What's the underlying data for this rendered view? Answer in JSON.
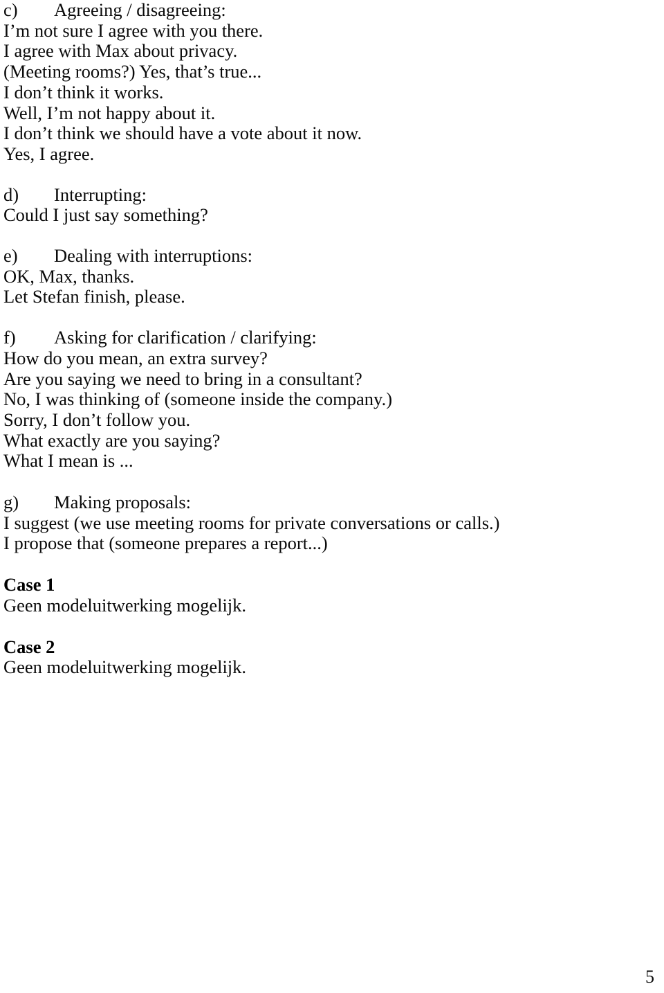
{
  "document": {
    "page_number": "5",
    "sections": [
      {
        "id": "section-c",
        "label": "c)",
        "title": "Agreeing / disagreeing:",
        "lines": [
          "I’m not sure I agree with you there.",
          "I agree with Max about privacy.",
          "(Meeting rooms?) Yes, that’s true...",
          "I don’t think it works.",
          "Well, I’m not happy about it.",
          "I don’t think we should have a vote about it now.",
          "Yes, I agree."
        ]
      },
      {
        "id": "section-d",
        "label": "d)",
        "title": "Interrupting:",
        "lines": [
          "Could I just say something?"
        ]
      },
      {
        "id": "section-e",
        "label": "e)",
        "title": "Dealing with interruptions:",
        "lines": [
          "OK, Max, thanks.",
          "Let Stefan finish, please."
        ]
      },
      {
        "id": "section-f",
        "label": "f)",
        "title": "Asking for clarification / clarifying:",
        "lines": [
          "How do you mean, an extra survey?",
          "Are you saying we need to bring in a consultant?",
          "No, I was thinking of (someone inside the company.)",
          "Sorry, I don’t follow you.",
          "What exactly are you saying?",
          "What I mean is ..."
        ]
      },
      {
        "id": "section-g",
        "label": "g)",
        "title": "Making proposals:",
        "lines": [
          "I suggest (we use meeting rooms for private conversations or calls.)",
          "I propose that (someone prepares a report...)"
        ]
      }
    ],
    "cases": [
      {
        "id": "case-1",
        "title": "Case 1",
        "body": "Geen modeluitwerking mogelijk."
      },
      {
        "id": "case-2",
        "title": "Case 2",
        "body": "Geen modeluitwerking mogelijk."
      }
    ]
  }
}
